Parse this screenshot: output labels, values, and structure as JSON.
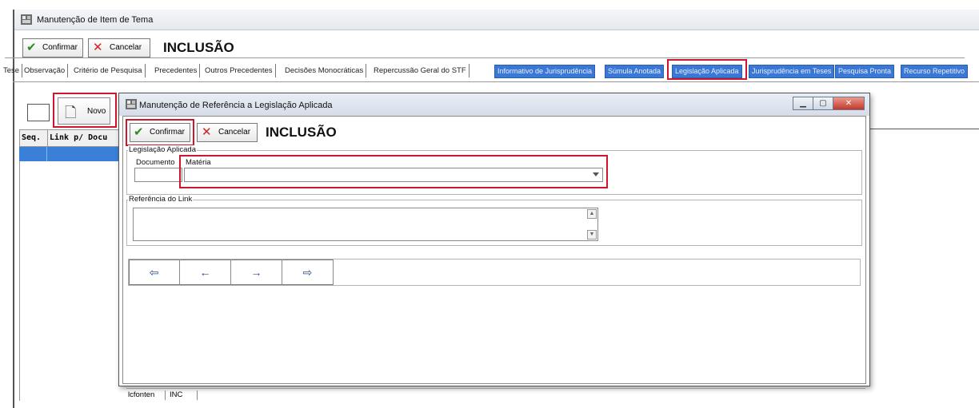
{
  "main_window": {
    "title": "Manutenção de Item de Tema",
    "toolbar": {
      "confirm_label": "Confirmar",
      "cancel_label": "Cancelar",
      "mode_heading": "INCLUSÃO"
    },
    "tabs": [
      {
        "label": "Tese",
        "style": "plain"
      },
      {
        "label": "Observação",
        "style": "plain"
      },
      {
        "label": "Critério de Pesquisa",
        "style": "plain"
      },
      {
        "label": "Precedentes",
        "style": "plain"
      },
      {
        "label": "Outros Precedentes",
        "style": "plain"
      },
      {
        "label": "Decisões Monocráticas",
        "style": "plain"
      },
      {
        "label": "Repercussão Geral do STF",
        "style": "plain"
      },
      {
        "label": "Informativo de Jurisprudência",
        "style": "blue"
      },
      {
        "label": "Súmula Anotada",
        "style": "blue"
      },
      {
        "label": "Legislação Aplicada",
        "style": "blue",
        "highlighted": true
      },
      {
        "label": "Jurisprudência em Teses",
        "style": "blue"
      },
      {
        "label": "Pesquisa Pronta",
        "style": "blue"
      },
      {
        "label": "Recurso Repetitivo",
        "style": "blue"
      }
    ],
    "new_button_label": "Novo",
    "grid": {
      "columns": [
        "Seq.",
        "Link p/ Docu"
      ]
    }
  },
  "dialog": {
    "title": "Manutenção de Referência a Legislação Aplicada",
    "toolbar": {
      "confirm_label": "Confirmar",
      "cancel_label": "Cancelar",
      "mode_heading": "INCLUSÃO"
    },
    "group_legislacao": {
      "label": "Legislação Aplicada",
      "documento_label": "Documento",
      "documento_value": "",
      "materia_label": "Matéria",
      "materia_value": ""
    },
    "group_referencia": {
      "label": "Referência do Link",
      "value": ""
    },
    "nav_buttons": [
      "⇦",
      "←",
      "→",
      "⇨"
    ],
    "status": {
      "panel1": "lcfonten",
      "panel2": "INC"
    }
  },
  "colors": {
    "highlight": "#d0162c",
    "tab_blue": "#3b78d6",
    "grid_selected": "#3a80d8",
    "confirm_icon": "#2e8b22",
    "cancel_icon": "#d32020"
  }
}
